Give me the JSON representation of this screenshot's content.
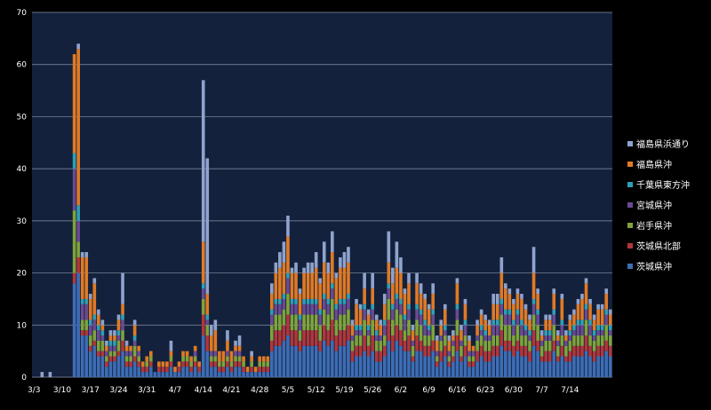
{
  "chart_data": {
    "type": "bar",
    "stacked": true,
    "background": "#000000",
    "plot_background": "#13213c",
    "gridline_color": "#8a93a6",
    "text_color": "#ffffff",
    "grid": true,
    "legend_position": "right",
    "ylim": [
      0,
      70
    ],
    "yticks": [
      0,
      10,
      20,
      30,
      40,
      50,
      60,
      70
    ],
    "x_start": "3/3",
    "x_end": "7/14",
    "xticks": [
      "3/3",
      "3/10",
      "3/17",
      "3/24",
      "3/31",
      "4/7",
      "4/14",
      "4/21",
      "4/28",
      "5/5",
      "5/12",
      "5/19",
      "5/26",
      "6/2",
      "6/9",
      "6/16",
      "6/23",
      "6/30",
      "7/7",
      "7/14"
    ],
    "series": [
      {
        "name": "茨城県沖",
        "color": "#3d6db5"
      },
      {
        "name": "茨城県北部",
        "color": "#b3363a"
      },
      {
        "name": "岩手県沖",
        "color": "#80a33a"
      },
      {
        "name": "宮城県沖",
        "color": "#6a4a92"
      },
      {
        "name": "千葉県東方沖",
        "color": "#2e9fb5"
      },
      {
        "name": "福島県沖",
        "color": "#e07a25"
      },
      {
        "name": "福島県浜通り",
        "color": "#8fa3cc"
      }
    ],
    "legend_order": [
      "福島県浜通り",
      "福島県沖",
      "千葉県東方沖",
      "宮城県沖",
      "岩手県沖",
      "茨城県北部",
      "茨城県沖"
    ],
    "totals": [
      0,
      0,
      1,
      0,
      1,
      0,
      0,
      0,
      0,
      0,
      62,
      64,
      24,
      24,
      16,
      19,
      13,
      11,
      7,
      9,
      9,
      12,
      20,
      7,
      6,
      11,
      6,
      3,
      4,
      5,
      1,
      3,
      3,
      3,
      7,
      2,
      3,
      5,
      5,
      4,
      6,
      3,
      57,
      42,
      10,
      11,
      5,
      5,
      9,
      5,
      7,
      8,
      4,
      2,
      5,
      2,
      4,
      4,
      4,
      18,
      22,
      24,
      26,
      31,
      21,
      22,
      17,
      21,
      22,
      22,
      24,
      19,
      26,
      22,
      28,
      20,
      23,
      24,
      25,
      11,
      15,
      14,
      20,
      13,
      20,
      12,
      11,
      16,
      28,
      21,
      26,
      23,
      17,
      20,
      10,
      20,
      18,
      16,
      14,
      18,
      8,
      11,
      14,
      8,
      9,
      19,
      10,
      15,
      8,
      6,
      11,
      13,
      12,
      11,
      16,
      16,
      23,
      18,
      17,
      15,
      17,
      16,
      14,
      12,
      25,
      17,
      9,
      12,
      12,
      17,
      9,
      16,
      9,
      12,
      13,
      15,
      16,
      19,
      15,
      12,
      14,
      14,
      17,
      13
    ],
    "stacks": [
      [
        0,
        0,
        0,
        0,
        0,
        0,
        0
      ],
      [
        0,
        0,
        0,
        0,
        0,
        0,
        0
      ],
      [
        0,
        0,
        0,
        0,
        0,
        0,
        1
      ],
      [
        0,
        0,
        0,
        0,
        0,
        0,
        0
      ],
      [
        0,
        0,
        0,
        0,
        0,
        0,
        1
      ],
      [
        0,
        0,
        0,
        0,
        0,
        0,
        0
      ],
      [
        0,
        0,
        0,
        0,
        0,
        0,
        0
      ],
      [
        0,
        0,
        0,
        0,
        0,
        0,
        0
      ],
      [
        0,
        0,
        0,
        0,
        0,
        0,
        0
      ],
      [
        0,
        0,
        0,
        0,
        0,
        0,
        0
      ],
      [
        18,
        2,
        12,
        8,
        3,
        19,
        0
      ],
      [
        20,
        3,
        3,
        4,
        3,
        30,
        1
      ],
      [
        8,
        1,
        2,
        3,
        1,
        8,
        1
      ],
      [
        8,
        1,
        2,
        3,
        1,
        8,
        1
      ],
      [
        5,
        1,
        2,
        2,
        1,
        4,
        1
      ],
      [
        6,
        1,
        2,
        2,
        1,
        6,
        1
      ],
      [
        4,
        1,
        2,
        2,
        1,
        2,
        1
      ],
      [
        4,
        1,
        2,
        1,
        1,
        1,
        1
      ],
      [
        2,
        1,
        1,
        1,
        0,
        1,
        1
      ],
      [
        3,
        1,
        1,
        1,
        1,
        1,
        1
      ],
      [
        3,
        1,
        1,
        1,
        1,
        1,
        1
      ],
      [
        4,
        1,
        2,
        1,
        1,
        2,
        1
      ],
      [
        5,
        2,
        2,
        2,
        1,
        2,
        6
      ],
      [
        2,
        1,
        1,
        1,
        0,
        1,
        1
      ],
      [
        2,
        1,
        1,
        1,
        0,
        1,
        0
      ],
      [
        3,
        1,
        2,
        1,
        1,
        2,
        1
      ],
      [
        2,
        1,
        1,
        1,
        0,
        1,
        0
      ],
      [
        1,
        1,
        0,
        0,
        0,
        1,
        0
      ],
      [
        1,
        1,
        1,
        0,
        0,
        1,
        0
      ],
      [
        2,
        1,
        1,
        0,
        0,
        1,
        0
      ],
      [
        1,
        0,
        0,
        0,
        0,
        0,
        0
      ],
      [
        1,
        1,
        0,
        0,
        0,
        1,
        0
      ],
      [
        1,
        1,
        0,
        0,
        0,
        1,
        0
      ],
      [
        1,
        1,
        0,
        0,
        0,
        1,
        0
      ],
      [
        2,
        1,
        1,
        0,
        0,
        1,
        2
      ],
      [
        1,
        0,
        0,
        0,
        0,
        1,
        0
      ],
      [
        1,
        1,
        0,
        0,
        0,
        1,
        0
      ],
      [
        2,
        1,
        1,
        0,
        0,
        1,
        0
      ],
      [
        2,
        1,
        1,
        0,
        0,
        1,
        0
      ],
      [
        1,
        1,
        1,
        0,
        0,
        1,
        0
      ],
      [
        2,
        1,
        1,
        1,
        0,
        1,
        0
      ],
      [
        1,
        1,
        0,
        0,
        0,
        1,
        0
      ],
      [
        8,
        4,
        3,
        2,
        1,
        8,
        31
      ],
      [
        5,
        3,
        2,
        1,
        1,
        4,
        26
      ],
      [
        2,
        1,
        1,
        1,
        0,
        3,
        2
      ],
      [
        2,
        1,
        1,
        1,
        0,
        4,
        2
      ],
      [
        1,
        1,
        1,
        0,
        0,
        2,
        0
      ],
      [
        1,
        1,
        1,
        0,
        0,
        2,
        0
      ],
      [
        2,
        1,
        1,
        1,
        0,
        2,
        2
      ],
      [
        1,
        1,
        1,
        0,
        0,
        2,
        0
      ],
      [
        2,
        1,
        1,
        1,
        0,
        1,
        1
      ],
      [
        2,
        1,
        1,
        1,
        0,
        1,
        2
      ],
      [
        1,
        1,
        1,
        0,
        0,
        1,
        0
      ],
      [
        1,
        0,
        0,
        0,
        0,
        1,
        0
      ],
      [
        1,
        1,
        1,
        0,
        0,
        1,
        1
      ],
      [
        1,
        0,
        0,
        0,
        0,
        1,
        0
      ],
      [
        1,
        1,
        1,
        0,
        0,
        1,
        0
      ],
      [
        1,
        1,
        1,
        0,
        0,
        1,
        0
      ],
      [
        1,
        1,
        1,
        0,
        0,
        1,
        0
      ],
      [
        5,
        2,
        3,
        2,
        1,
        3,
        2
      ],
      [
        6,
        3,
        3,
        2,
        1,
        5,
        2
      ],
      [
        6,
        3,
        3,
        2,
        1,
        6,
        3
      ],
      [
        7,
        3,
        3,
        2,
        1,
        6,
        4
      ],
      [
        8,
        4,
        4,
        3,
        1,
        7,
        4
      ],
      [
        6,
        3,
        3,
        2,
        1,
        5,
        1
      ],
      [
        6,
        3,
        3,
        2,
        1,
        5,
        2
      ],
      [
        5,
        2,
        2,
        2,
        1,
        4,
        1
      ],
      [
        6,
        3,
        3,
        2,
        1,
        5,
        1
      ],
      [
        6,
        3,
        3,
        2,
        1,
        5,
        2
      ],
      [
        6,
        3,
        3,
        2,
        1,
        5,
        2
      ],
      [
        6,
        3,
        3,
        2,
        1,
        6,
        3
      ],
      [
        5,
        2,
        3,
        2,
        1,
        5,
        1
      ],
      [
        7,
        3,
        3,
        2,
        1,
        6,
        4
      ],
      [
        6,
        3,
        3,
        2,
        1,
        5,
        2
      ],
      [
        7,
        4,
        4,
        2,
        1,
        6,
        4
      ],
      [
        5,
        3,
        3,
        2,
        1,
        5,
        1
      ],
      [
        6,
        3,
        3,
        2,
        1,
        6,
        2
      ],
      [
        6,
        3,
        3,
        2,
        1,
        6,
        3
      ],
      [
        7,
        3,
        3,
        2,
        1,
        6,
        3
      ],
      [
        3,
        2,
        2,
        1,
        0,
        2,
        1
      ],
      [
        4,
        2,
        2,
        1,
        1,
        4,
        1
      ],
      [
        4,
        2,
        2,
        1,
        1,
        3,
        1
      ],
      [
        5,
        3,
        3,
        2,
        1,
        3,
        3
      ],
      [
        4,
        2,
        2,
        1,
        1,
        2,
        1
      ],
      [
        5,
        3,
        3,
        2,
        1,
        3,
        3
      ],
      [
        3,
        2,
        2,
        1,
        1,
        2,
        1
      ],
      [
        3,
        2,
        2,
        1,
        0,
        2,
        1
      ],
      [
        4,
        2,
        2,
        2,
        1,
        3,
        2
      ],
      [
        7,
        4,
        4,
        2,
        1,
        4,
        6
      ],
      [
        5,
        3,
        3,
        2,
        1,
        4,
        3
      ],
      [
        7,
        3,
        3,
        2,
        1,
        5,
        5
      ],
      [
        6,
        3,
        3,
        2,
        1,
        5,
        3
      ],
      [
        5,
        2,
        2,
        2,
        1,
        4,
        1
      ],
      [
        5,
        3,
        3,
        2,
        1,
        4,
        2
      ],
      [
        3,
        1,
        2,
        1,
        0,
        2,
        1
      ],
      [
        5,
        3,
        3,
        2,
        1,
        4,
        2
      ],
      [
        5,
        2,
        3,
        2,
        1,
        3,
        2
      ],
      [
        4,
        2,
        2,
        2,
        1,
        4,
        1
      ],
      [
        4,
        2,
        2,
        1,
        1,
        3,
        1
      ],
      [
        5,
        2,
        3,
        2,
        1,
        3,
        2
      ],
      [
        2,
        1,
        1,
        1,
        0,
        2,
        1
      ],
      [
        3,
        2,
        2,
        1,
        0,
        2,
        1
      ],
      [
        4,
        2,
        2,
        1,
        1,
        3,
        1
      ],
      [
        2,
        1,
        1,
        1,
        0,
        2,
        1
      ],
      [
        3,
        1,
        2,
        1,
        0,
        1,
        1
      ],
      [
        5,
        3,
        3,
        2,
        1,
        4,
        1
      ],
      [
        3,
        1,
        2,
        1,
        0,
        2,
        1
      ],
      [
        4,
        2,
        2,
        2,
        1,
        3,
        1
      ],
      [
        2,
        1,
        1,
        1,
        0,
        2,
        1
      ],
      [
        2,
        1,
        1,
        1,
        0,
        1,
        0
      ],
      [
        3,
        2,
        2,
        1,
        0,
        2,
        1
      ],
      [
        4,
        2,
        2,
        1,
        1,
        2,
        1
      ],
      [
        3,
        2,
        2,
        1,
        1,
        2,
        1
      ],
      [
        3,
        2,
        2,
        1,
        0,
        2,
        1
      ],
      [
        4,
        2,
        2,
        2,
        1,
        3,
        2
      ],
      [
        4,
        2,
        2,
        2,
        1,
        3,
        2
      ],
      [
        6,
        3,
        3,
        2,
        1,
        5,
        3
      ],
      [
        5,
        2,
        3,
        2,
        1,
        4,
        1
      ],
      [
        5,
        2,
        3,
        2,
        1,
        3,
        1
      ],
      [
        4,
        2,
        2,
        2,
        1,
        3,
        1
      ],
      [
        5,
        2,
        3,
        2,
        1,
        3,
        1
      ],
      [
        4,
        2,
        2,
        2,
        1,
        4,
        1
      ],
      [
        4,
        2,
        2,
        1,
        1,
        3,
        1
      ],
      [
        3,
        2,
        2,
        1,
        1,
        2,
        1
      ],
      [
        6,
        3,
        3,
        2,
        1,
        5,
        5
      ],
      [
        5,
        2,
        3,
        2,
        1,
        3,
        1
      ],
      [
        3,
        1,
        2,
        1,
        0,
        1,
        1
      ],
      [
        3,
        2,
        2,
        1,
        1,
        2,
        1
      ],
      [
        3,
        2,
        2,
        1,
        1,
        2,
        1
      ],
      [
        5,
        2,
        3,
        2,
        1,
        3,
        1
      ],
      [
        3,
        1,
        2,
        1,
        0,
        1,
        1
      ],
      [
        4,
        2,
        2,
        2,
        1,
        4,
        1
      ],
      [
        3,
        1,
        2,
        1,
        0,
        1,
        1
      ],
      [
        3,
        2,
        2,
        1,
        1,
        2,
        1
      ],
      [
        4,
        2,
        2,
        1,
        1,
        2,
        1
      ],
      [
        4,
        2,
        2,
        2,
        1,
        3,
        1
      ],
      [
        4,
        2,
        2,
        2,
        1,
        4,
        1
      ],
      [
        5,
        3,
        3,
        2,
        1,
        4,
        1
      ],
      [
        4,
        2,
        2,
        2,
        1,
        3,
        1
      ],
      [
        3,
        2,
        2,
        1,
        1,
        2,
        1
      ],
      [
        4,
        2,
        2,
        1,
        1,
        3,
        1
      ],
      [
        4,
        2,
        2,
        1,
        1,
        3,
        1
      ],
      [
        5,
        2,
        3,
        2,
        1,
        3,
        1
      ],
      [
        4,
        2,
        2,
        1,
        1,
        2,
        1
      ]
    ]
  }
}
